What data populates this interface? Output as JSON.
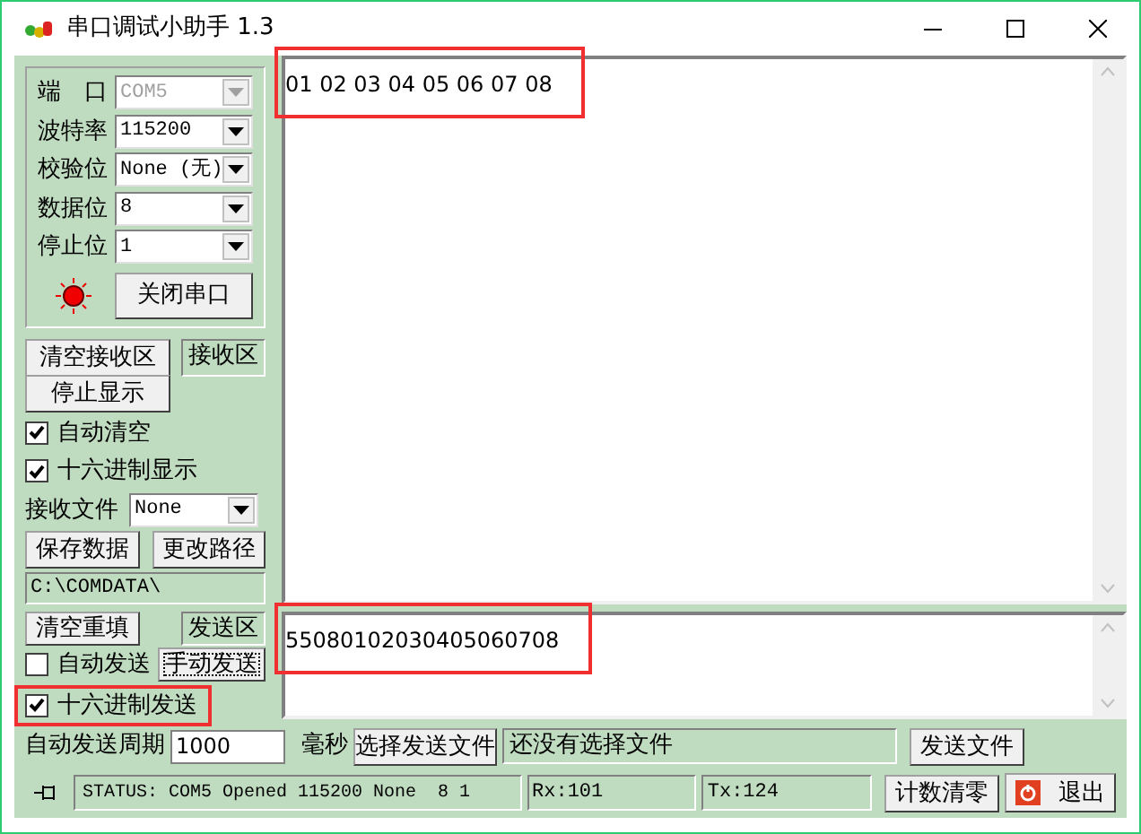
{
  "window": {
    "title": "串口调试小助手 1.3"
  },
  "port_settings": [
    {
      "label": "端　口",
      "value": "COM5",
      "disabled": true
    },
    {
      "label": "波特率",
      "value": "115200",
      "disabled": false
    },
    {
      "label": "校验位",
      "value": "None (无)",
      "disabled": false
    },
    {
      "label": "数据位",
      "value": "8",
      "disabled": false
    },
    {
      "label": "停止位",
      "value": "1",
      "disabled": false
    }
  ],
  "led": {
    "on": true
  },
  "open_button": "关闭串口",
  "receive": {
    "clear_button": "清空接收区",
    "area_label": "接收区",
    "stop_button": "停止显示",
    "options": [
      {
        "label": "自动清空",
        "checked": true
      },
      {
        "label": "十六进制显示",
        "checked": true
      }
    ],
    "file_label": "接收文件",
    "file_value": "None",
    "save_button": "保存数据",
    "path_button": "更改路径",
    "path": "C:\\COMDATA\\",
    "text": "01 02 03 04 05 06 07 08",
    "highlighted": true
  },
  "send": {
    "clear_button": "清空重填",
    "area_label": "发送区",
    "auto_send": {
      "label": "自动发送",
      "checked": false
    },
    "manual_button": "手动发送",
    "hex_send": {
      "label": "十六进制发送",
      "checked": true,
      "highlighted": true
    },
    "text": "55080102030405060708",
    "highlighted": true,
    "period_label": "自动发送周期",
    "period_value": "1000",
    "unit": "毫秒",
    "choose_file_button": "选择发送文件",
    "file_status": "还没有选择文件",
    "send_file_button": "发送文件"
  },
  "status_bar": {
    "status": "STATUS: COM5 Opened 115200 None  8 1",
    "rx": "Rx:101",
    "tx": "Tx:124",
    "reset_button": "计数清零",
    "exit_button": "退出"
  }
}
